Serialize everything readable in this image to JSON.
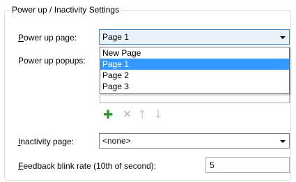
{
  "group": {
    "title": "Power up / Inactivity Settings"
  },
  "power_up_page": {
    "label_mnemonic": "P",
    "label_rest": "ower up page:",
    "value": "Page 1",
    "options": [
      "New Page",
      "Page 1",
      "Page 2",
      "Page 3"
    ],
    "selected_index": 1
  },
  "power_up_popups": {
    "label": "Power up popups:"
  },
  "toolbar": {
    "add_glyph": "✚",
    "remove_glyph": "✕",
    "up_glyph": "🡑",
    "down_glyph": "🡓",
    "add_color": "#2e9a2e",
    "disabled_color": "#b9b9b9"
  },
  "inactivity_page": {
    "label_mnemonic": "I",
    "label_rest": "nactivity page:",
    "value": "<none>"
  },
  "feedback": {
    "label_mnemonic": "F",
    "label_rest": "eedback blink rate (10th of second):",
    "value": "5"
  }
}
